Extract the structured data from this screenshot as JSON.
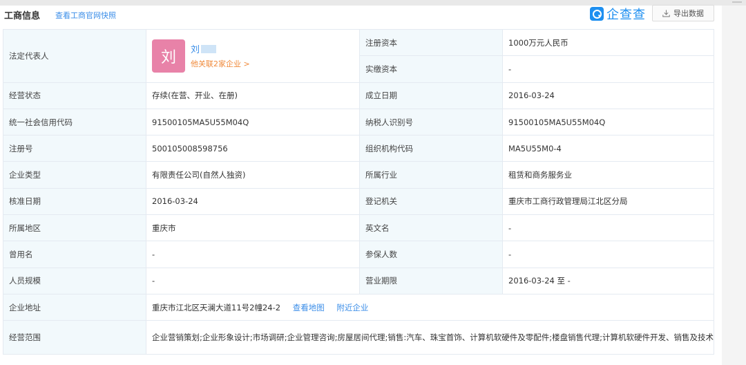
{
  "header": {
    "title": "工商信息",
    "snapshot_link": "查看工商官网快照",
    "brand_name": "企查查",
    "export_label": "导出数据",
    "icons": {
      "brand": "qichacha-logo-icon",
      "export": "download-icon"
    }
  },
  "colors": {
    "accent": "#3b8ee8",
    "label_bg": "#f2f9fc",
    "orange": "#f08a3b",
    "avatar": "#e882a8"
  },
  "rows": {
    "legal_rep": {
      "label": "法定代表人",
      "avatar_char": "刘",
      "name": "刘",
      "related": "他关联2家企业 >"
    },
    "reg_capital": {
      "label": "注册资本",
      "value": "1000万元人民币"
    },
    "paid_capital": {
      "label": "实缴资本",
      "value": "-"
    },
    "status": {
      "label": "经营状态",
      "value": "存续(在营、开业、在册)"
    },
    "founded": {
      "label": "成立日期",
      "value": "2016-03-24"
    },
    "credit_code": {
      "label": "统一社会信用代码",
      "value": "91500105MA5U55M04Q"
    },
    "taxpayer_id": {
      "label": "纳税人识别号",
      "value": "91500105MA5U55M04Q"
    },
    "reg_no": {
      "label": "注册号",
      "value": "500105008598756"
    },
    "org_code": {
      "label": "组织机构代码",
      "value": "MA5U55M0-4"
    },
    "company_type": {
      "label": "企业类型",
      "value": "有限责任公司(自然人独资)"
    },
    "industry": {
      "label": "所属行业",
      "value": "租赁和商务服务业"
    },
    "approval_date": {
      "label": "核准日期",
      "value": "2016-03-24"
    },
    "authority": {
      "label": "登记机关",
      "value": "重庆市工商行政管理局江北区分局"
    },
    "region": {
      "label": "所属地区",
      "value": "重庆市"
    },
    "english_name": {
      "label": "英文名",
      "value": "-"
    },
    "former_name": {
      "label": "曾用名",
      "value": "-"
    },
    "insured": {
      "label": "参保人数",
      "value": "-"
    },
    "staff_size": {
      "label": "人员规模",
      "value": "-"
    },
    "term": {
      "label": "营业期限",
      "value": "2016-03-24 至 -"
    },
    "address": {
      "label": "企业地址",
      "value": "重庆市江北区天澜大道11号2幢24-2",
      "map_link": "查看地图",
      "nearby_link": "附近企业"
    },
    "scope": {
      "label": "经营范围",
      "value": "企业营销策划;企业形象设计;市场调研;企业管理咨询;房屋居间代理;销售:汽车、珠宝首饰、计算机软硬件及零配件;楼盘销售代理;计算机软硬件开发、销售及技术服务;网页设计;计算机网络设备研发、技术推广宣传及技术服务。** [依法须经批准的项目,经相关部门批准后方可开展经营活动]"
    }
  }
}
